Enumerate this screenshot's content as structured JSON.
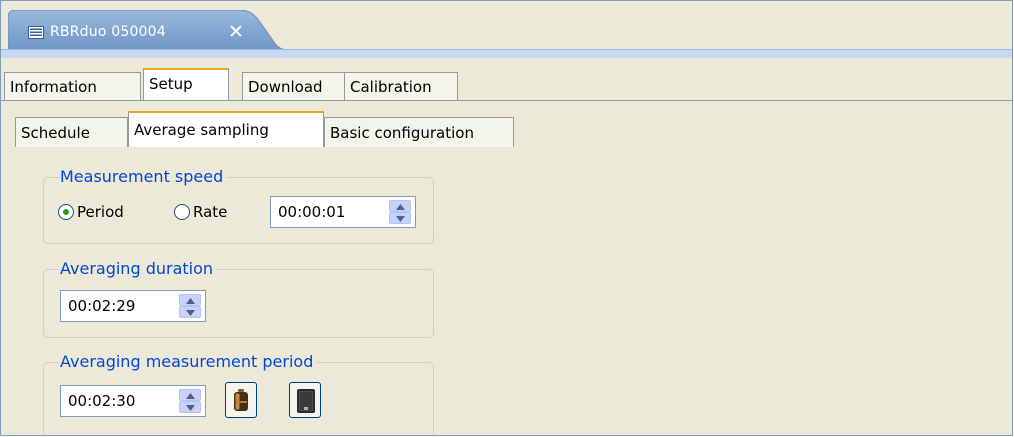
{
  "editor_tab": {
    "title": "RBRduo 050004",
    "close_label": "✕"
  },
  "tabs_top": [
    {
      "label": "Information"
    },
    {
      "label": "Setup",
      "active": true
    },
    {
      "label": "Download"
    },
    {
      "label": "Calibration"
    }
  ],
  "tabs_sub": [
    {
      "label": "Schedule"
    },
    {
      "label": "Average sampling",
      "active": true
    },
    {
      "label": "Basic configuration"
    }
  ],
  "measurement_speed": {
    "legend": "Measurement speed",
    "period_label": "Period",
    "rate_label": "Rate",
    "selected": "Period",
    "value": "00:00:01"
  },
  "averaging_duration": {
    "legend": "Averaging duration",
    "value": "00:02:29"
  },
  "averaging_period": {
    "legend": "Averaging measurement period",
    "value": "00:02:30",
    "battery_icon": "battery-icon",
    "memory_icon": "memory-icon"
  },
  "colors": {
    "accent": "#0046d5",
    "tab_highlight": "#e8a72a",
    "editor_tab": "#7da2ce"
  }
}
